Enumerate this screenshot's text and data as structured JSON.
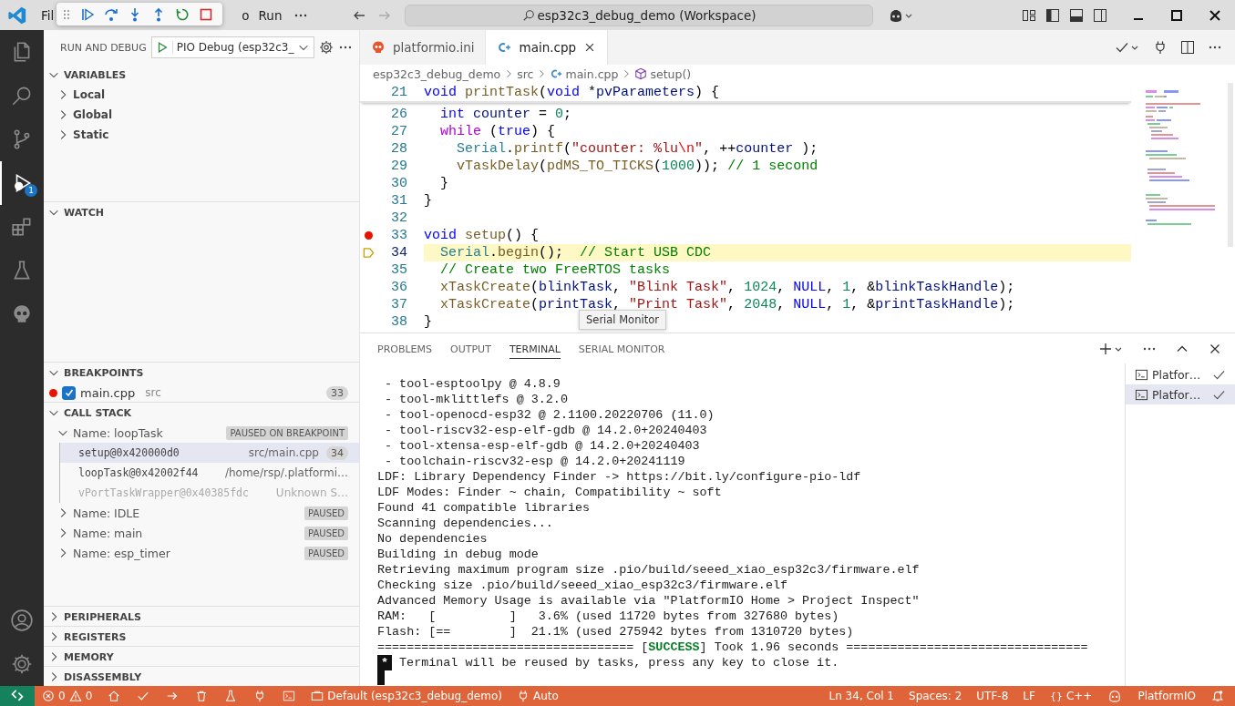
{
  "title_bar": {
    "menus": [
      "Fil",
      "o",
      "Run"
    ],
    "command_center": "esp32c3_debug_demo (Workspace)"
  },
  "activity_bar": {
    "items": [
      {
        "selected": false
      },
      {
        "selected": false
      },
      {
        "selected": false
      },
      {
        "selected": true,
        "badge": "1"
      },
      {
        "selected": false
      },
      {
        "selected": false
      },
      {
        "selected": false
      }
    ]
  },
  "sidebar": {
    "title": "RUN AND DEBUG",
    "config": "PIO Debug (esp32c3_",
    "variables": {
      "title": "VARIABLES",
      "expanded": true,
      "scopes": [
        {
          "name": "Local",
          "expanded": false
        },
        {
          "name": "Global",
          "expanded": false
        },
        {
          "name": "Static",
          "expanded": false
        }
      ]
    },
    "watch": {
      "title": "WATCH",
      "expanded": true
    },
    "breakpoints": {
      "title": "BREAKPOINTS",
      "expanded": true,
      "items": [
        {
          "file": "main.cpp",
          "folder": "src",
          "line": "33",
          "checked": true
        }
      ]
    },
    "call_stack": {
      "title": "CALL STACK",
      "expanded": true,
      "threads": [
        {
          "name": "Name: loopTask",
          "status": "PAUSED ON BREAKPOINT",
          "expanded": true,
          "frames": [
            {
              "function": "setup@0x420000d0",
              "source": "src/main.cpp",
              "line": "34",
              "selected": true,
              "dimmed": false
            },
            {
              "function": "loopTask@0x42002f44",
              "source": "/home/rsp/.platformi…",
              "selected": false,
              "dimmed": false
            },
            {
              "function": "vPortTaskWrapper@0x40385fdc",
              "source": "Unknown S…",
              "selected": false,
              "dimmed": true
            }
          ]
        },
        {
          "name": "Name: IDLE",
          "status": "PAUSED",
          "expanded": false
        },
        {
          "name": "Name: main",
          "status": "PAUSED",
          "expanded": false
        },
        {
          "name": "Name: esp_timer",
          "status": "PAUSED",
          "expanded": false
        }
      ]
    },
    "collapsed_sections": [
      {
        "title": "PERIPHERALS",
        "expanded": false
      },
      {
        "title": "REGISTERS",
        "expanded": false
      },
      {
        "title": "MEMORY",
        "expanded": false
      },
      {
        "title": "DISASSEMBLY",
        "expanded": false
      }
    ]
  },
  "editor": {
    "tabs": [
      {
        "label": "platformio.ini",
        "kind": "ini",
        "selected": false
      },
      {
        "label": "main.cpp",
        "kind": "cpp",
        "selected": true
      }
    ],
    "breadcrumbs": [
      {
        "label": "esp32c3_debug_demo",
        "kind": "folder"
      },
      {
        "label": "src",
        "kind": "folder"
      },
      {
        "label": "main.cpp",
        "kind": "file"
      },
      {
        "label": "setup()",
        "kind": "symbol"
      }
    ],
    "lines": [
      {
        "number": "21",
        "sticky": true,
        "breakpoint": false,
        "current": false,
        "segments": [
          {
            "text": "void",
            "kind": "kw"
          },
          {
            "text": " printTask",
            "kind": "fn"
          },
          {
            "text": "(",
            "kind": "plain"
          },
          {
            "text": "void",
            "kind": "kw"
          },
          {
            "text": " *",
            "kind": "plain"
          },
          {
            "text": "pvParameters",
            "kind": "var"
          },
          {
            "text": ") {",
            "kind": "plain"
          }
        ]
      },
      {
        "number": "26",
        "sticky": false,
        "breakpoint": false,
        "current": false,
        "segments": [
          {
            "text": "  int",
            "kind": "kw"
          },
          {
            "text": " counter",
            "kind": "var"
          },
          {
            "text": " = ",
            "kind": "plain"
          },
          {
            "text": "0",
            "kind": "num"
          },
          {
            "text": ";",
            "kind": "plain"
          }
        ]
      },
      {
        "number": "27",
        "sticky": false,
        "breakpoint": false,
        "current": false,
        "segments": [
          {
            "text": "  while",
            "kind": "ctrl"
          },
          {
            "text": " (",
            "kind": "plain"
          },
          {
            "text": "true",
            "kind": "kw"
          },
          {
            "text": ") {",
            "kind": "plain"
          }
        ]
      },
      {
        "number": "28",
        "sticky": false,
        "breakpoint": false,
        "current": false,
        "segments": [
          {
            "text": "    Serial",
            "kind": "cls"
          },
          {
            "text": ".",
            "kind": "plain"
          },
          {
            "text": "printf",
            "kind": "fn"
          },
          {
            "text": "(",
            "kind": "plain"
          },
          {
            "text": "\"counter: %lu",
            "kind": "str"
          },
          {
            "text": "\\n",
            "kind": "esc"
          },
          {
            "text": "\"",
            "kind": "str"
          },
          {
            "text": ", ++",
            "kind": "plain"
          },
          {
            "text": "counter",
            "kind": "var"
          },
          {
            "text": " );",
            "kind": "plain"
          }
        ]
      },
      {
        "number": "29",
        "sticky": false,
        "breakpoint": false,
        "current": false,
        "segments": [
          {
            "text": "    vTaskDelay",
            "kind": "fn"
          },
          {
            "text": "(",
            "kind": "plain"
          },
          {
            "text": "pdMS_TO_TICKS",
            "kind": "fn"
          },
          {
            "text": "(",
            "kind": "plain"
          },
          {
            "text": "1000",
            "kind": "num"
          },
          {
            "text": ")); ",
            "kind": "plain"
          },
          {
            "text": "// 1 second",
            "kind": "cmt"
          }
        ]
      },
      {
        "number": "30",
        "sticky": false,
        "breakpoint": false,
        "current": false,
        "segments": [
          {
            "text": "  }",
            "kind": "plain"
          }
        ]
      },
      {
        "number": "31",
        "sticky": false,
        "breakpoint": false,
        "current": false,
        "segments": [
          {
            "text": "}",
            "kind": "plain"
          }
        ]
      },
      {
        "number": "32",
        "sticky": false,
        "breakpoint": false,
        "current": false
      },
      {
        "number": "33",
        "sticky": false,
        "breakpoint": true,
        "current": false,
        "segments": [
          {
            "text": "void",
            "kind": "kw"
          },
          {
            "text": " setup",
            "kind": "fn"
          },
          {
            "text": "() {",
            "kind": "plain"
          }
        ]
      },
      {
        "number": "34",
        "sticky": false,
        "breakpoint": false,
        "current": true,
        "segments": [
          {
            "text": "  Serial",
            "kind": "cls"
          },
          {
            "text": ".",
            "kind": "plain"
          },
          {
            "text": "begin",
            "kind": "fn"
          },
          {
            "text": "();  ",
            "kind": "plain"
          },
          {
            "text": "// Start USB CDC",
            "kind": "cmt"
          }
        ]
      },
      {
        "number": "35",
        "sticky": false,
        "breakpoint": false,
        "current": false,
        "segments": [
          {
            "text": "  // Create two FreeRTOS tasks",
            "kind": "cmt"
          }
        ]
      },
      {
        "number": "36",
        "sticky": false,
        "breakpoint": false,
        "current": false,
        "segments": [
          {
            "text": "  xTaskCreate",
            "kind": "fn"
          },
          {
            "text": "(",
            "kind": "plain"
          },
          {
            "text": "blinkTask",
            "kind": "var"
          },
          {
            "text": ", ",
            "kind": "plain"
          },
          {
            "text": "\"Blink Task\"",
            "kind": "str"
          },
          {
            "text": ", ",
            "kind": "plain"
          },
          {
            "text": "1024",
            "kind": "num"
          },
          {
            "text": ", ",
            "kind": "plain"
          },
          {
            "text": "NULL",
            "kind": "kw"
          },
          {
            "text": ", ",
            "kind": "plain"
          },
          {
            "text": "1",
            "kind": "num"
          },
          {
            "text": ", &",
            "kind": "plain"
          },
          {
            "text": "blinkTaskHandle",
            "kind": "var"
          },
          {
            "text": ");",
            "kind": "plain"
          }
        ]
      },
      {
        "number": "37",
        "sticky": false,
        "breakpoint": false,
        "current": false,
        "segments": [
          {
            "text": "  xTaskCreate",
            "kind": "fn"
          },
          {
            "text": "(",
            "kind": "plain"
          },
          {
            "text": "printTask",
            "kind": "var"
          },
          {
            "text": ", ",
            "kind": "plain"
          },
          {
            "text": "\"Print Task\"",
            "kind": "str"
          },
          {
            "text": ", ",
            "kind": "plain"
          },
          {
            "text": "2048",
            "kind": "num"
          },
          {
            "text": ", ",
            "kind": "plain"
          },
          {
            "text": "NULL",
            "kind": "kw"
          },
          {
            "text": ", ",
            "kind": "plain"
          },
          {
            "text": "1",
            "kind": "num"
          },
          {
            "text": ", &",
            "kind": "plain"
          },
          {
            "text": "printTaskHandle",
            "kind": "var"
          },
          {
            "text": ");",
            "kind": "plain"
          }
        ]
      },
      {
        "number": "38",
        "sticky": false,
        "breakpoint": false,
        "current": false,
        "segments": [
          {
            "text": "}",
            "kind": "plain"
          }
        ]
      }
    ]
  },
  "panel": {
    "tabs": [
      {
        "label": "PROBLEMS",
        "selected": false
      },
      {
        "label": "OUTPUT",
        "selected": false
      },
      {
        "label": "TERMINAL",
        "selected": true
      },
      {
        "label": "SERIAL MONITOR",
        "selected": false
      }
    ],
    "tooltip": "Serial Monitor",
    "terminal_lines": [
      " - tool-esptoolpy @ 4.8.9",
      " - tool-mklittlefs @ 3.2.0",
      " - tool-openocd-esp32 @ 2.1100.20220706 (11.0)",
      " - tool-riscv32-esp-elf-gdb @ 14.2.0+20240403",
      " - tool-xtensa-esp-elf-gdb @ 14.2.0+20240403",
      " - toolchain-riscv32-esp @ 14.2.0+20241119",
      "LDF: Library Dependency Finder -> https://bit.ly/configure-pio-ldf",
      "LDF Modes: Finder ~ chain, Compatibility ~ soft",
      "Found 41 compatible libraries",
      "Scanning dependencies...",
      "No dependencies",
      "Building in debug mode",
      "Retrieving maximum program size .pio/build/seeed_xiao_esp32c3/firmware.elf",
      "Checking size .pio/build/seeed_xiao_esp32c3/firmware.elf",
      "Advanced Memory Usage is available via \"PlatformIO Home > Project Inspect\"",
      "RAM:   [          ]   3.6% (used 11720 bytes from 327680 bytes)",
      "Flash: [==        ]  21.1% (used 275942 bytes from 1310720 bytes)",
      "=================================== [**SUCCESS**] Took 1.96 seconds ================================="
    ],
    "prompt": {
      "marker": "*",
      "text": " Terminal will be reused by tasks, press any key to close it."
    },
    "terminals": [
      {
        "label": "Platfor…",
        "selected": false
      },
      {
        "label": "Platfor…",
        "selected": true
      }
    ]
  },
  "status_bar": {
    "errors": "0",
    "warnings": "0",
    "environment": "Default (esp32c3_debug_demo)",
    "port": "Auto",
    "position": "Ln 34, Col 1",
    "indent": "Spaces: 2",
    "encoding": "UTF-8",
    "eol": "LF",
    "language_icon": "{}",
    "language": "C++",
    "platform": "PlatformIO"
  }
}
